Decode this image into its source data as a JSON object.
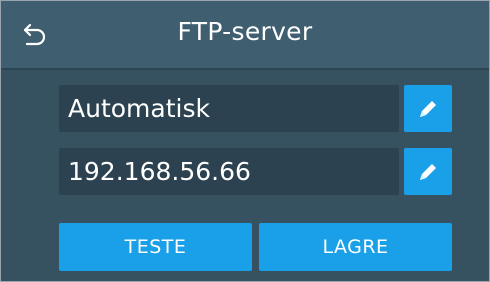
{
  "header": {
    "title": "FTP-server",
    "back_icon": "back-arrow-icon"
  },
  "fields": [
    {
      "value": "Automatisk",
      "edit_icon": "pencil-icon"
    },
    {
      "value": "192.168.56.66",
      "edit_icon": "pencil-icon"
    }
  ],
  "actions": {
    "test_label": "TESTE",
    "save_label": "LAGRE"
  },
  "colors": {
    "background": "#36515f",
    "header": "#3f5f70",
    "field": "#2c4250",
    "accent": "#1aa0e8",
    "text": "#ffffff"
  }
}
